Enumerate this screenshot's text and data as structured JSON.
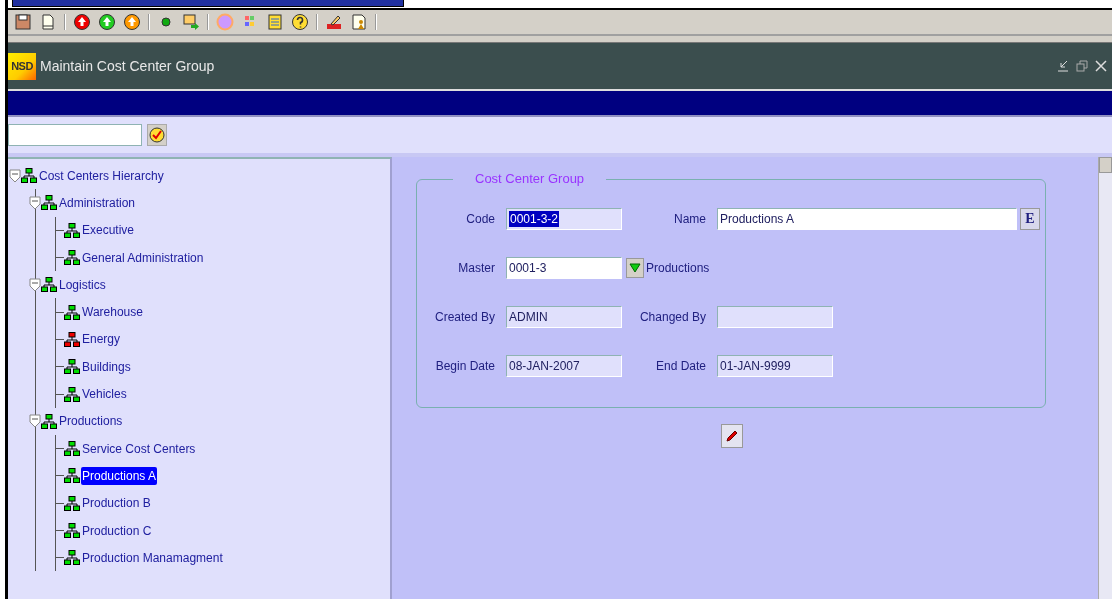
{
  "window": {
    "logo": "NSD",
    "title": "Maintain Cost Center Group"
  },
  "tree": {
    "label": "Cost Centers Hierarchy",
    "color": "#00dd00",
    "selected": false,
    "expanded": true,
    "children": [
      {
        "label": "Administration",
        "color": "#00dd00",
        "selected": false,
        "expanded": true,
        "children": [
          {
            "label": "Executive",
            "color": "#00dd00",
            "selected": false
          },
          {
            "label": "General Administration",
            "color": "#00dd00",
            "selected": false
          }
        ]
      },
      {
        "label": "Logistics",
        "color": "#00dd00",
        "selected": false,
        "expanded": true,
        "children": [
          {
            "label": "Warehouse",
            "color": "#00dd00",
            "selected": false
          },
          {
            "label": "Energy",
            "color": "#ee0000",
            "selected": false
          },
          {
            "label": "Buildings",
            "color": "#00dd00",
            "selected": false
          },
          {
            "label": "Vehicles",
            "color": "#00dd00",
            "selected": false
          }
        ]
      },
      {
        "label": "Productions",
        "color": "#00dd00",
        "selected": false,
        "expanded": true,
        "children": [
          {
            "label": "Service Cost Centers",
            "color": "#00dd00",
            "selected": false
          },
          {
            "label": "Productions A",
            "color": "#00dd00",
            "selected": true
          },
          {
            "label": "Production B",
            "color": "#00dd00",
            "selected": false
          },
          {
            "label": "Production C",
            "color": "#00dd00",
            "selected": false
          },
          {
            "label": "Production Manamagment",
            "color": "#00dd00",
            "selected": false
          }
        ]
      }
    ]
  },
  "form": {
    "title": "Cost Center Group",
    "rows": [
      [
        {
          "kind": "text",
          "label": "Code",
          "value": "0001-3-2",
          "readonly": true,
          "highlighted": true
        },
        {
          "kind": "editor",
          "label": "Name",
          "value": "Productions A",
          "readonly": false,
          "highlighted": false,
          "button": "E"
        }
      ],
      [
        {
          "kind": "lookup",
          "label": "Master",
          "value": "0001-3",
          "readonly": false,
          "highlighted": false,
          "description": "Productions"
        }
      ],
      [
        {
          "kind": "text",
          "label": "Created By",
          "value": "ADMIN",
          "readonly": true,
          "highlighted": false
        },
        {
          "kind": "text",
          "label": "Changed By",
          "readonly": true
        }
      ],
      [
        {
          "kind": "text",
          "label": "Begin Date",
          "value": "08-JAN-2007",
          "readonly": true,
          "highlighted": false
        },
        {
          "kind": "text",
          "label": "End Date",
          "value": "01-JAN-9999",
          "readonly": true,
          "highlighted": false
        }
      ]
    ]
  }
}
